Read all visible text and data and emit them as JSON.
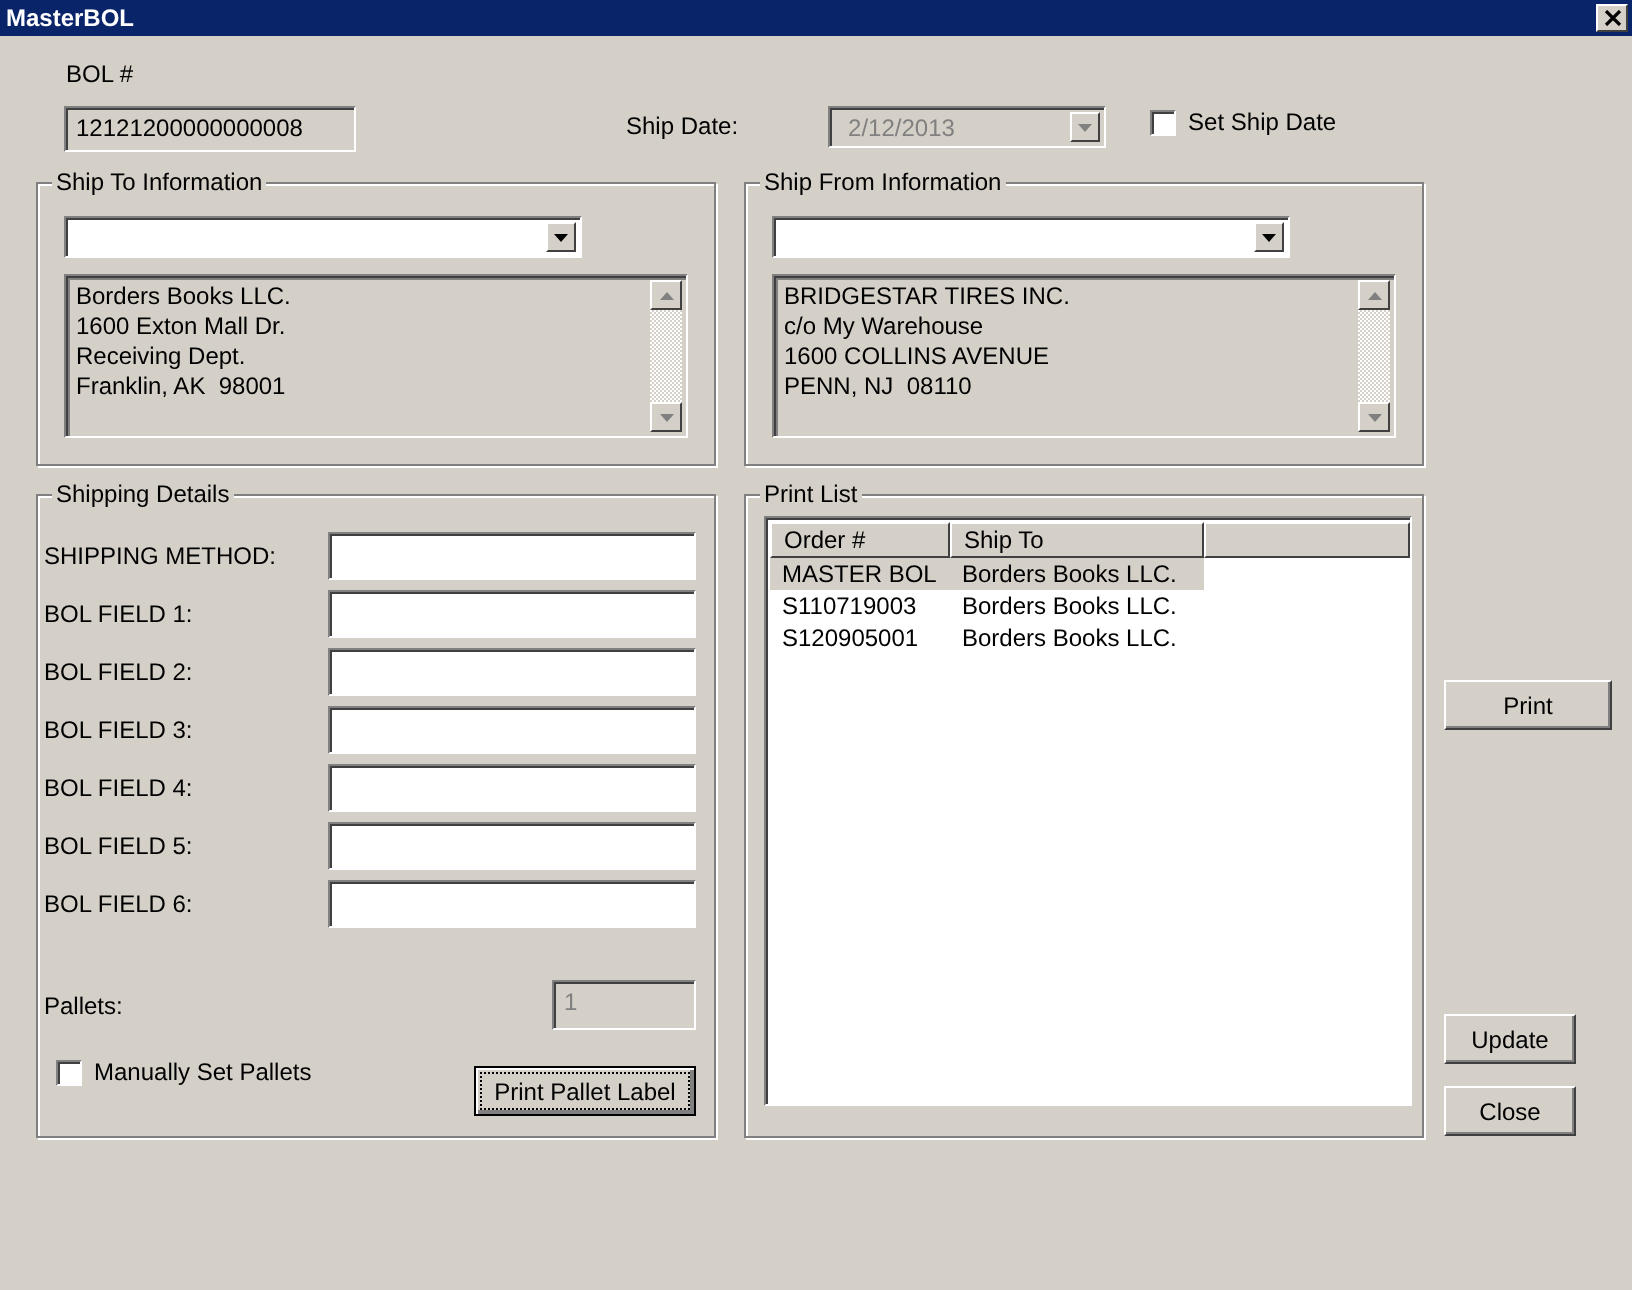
{
  "window": {
    "title": "MasterBOL"
  },
  "bol": {
    "label": "BOL #",
    "value": "12121200000000008"
  },
  "ship_date": {
    "label": "Ship Date:",
    "value": "2/12/2013",
    "disabled": true
  },
  "set_ship_date": {
    "label": "Set Ship Date",
    "checked": false
  },
  "ship_to": {
    "title": "Ship To Information",
    "address": [
      "Borders Books LLC.",
      "1600 Exton Mall Dr.",
      "Receiving Dept.",
      "Franklin, AK  98001"
    ]
  },
  "ship_from": {
    "title": "Ship From Information",
    "address": [
      "BRIDGESTAR TIRES INC.",
      "c/o My Warehouse",
      "1600 COLLINS AVENUE",
      "PENN, NJ  08110"
    ]
  },
  "shipping_details": {
    "title": "Shipping Details",
    "fields": [
      {
        "label": "SHIPPING METHOD:"
      },
      {
        "label": "BOL FIELD 1:"
      },
      {
        "label": "BOL FIELD 2:"
      },
      {
        "label": "BOL FIELD 3:"
      },
      {
        "label": "BOL FIELD 4:"
      },
      {
        "label": "BOL FIELD 5:"
      },
      {
        "label": "BOL FIELD 6:"
      }
    ],
    "pallets": {
      "label": "Pallets:",
      "value": "1",
      "disabled": true
    },
    "manual_pallets": {
      "label": "Manually Set Pallets",
      "checked": false
    },
    "print_pallet_label": "Print Pallet Label"
  },
  "print_list": {
    "title": "Print List",
    "columns": [
      "Order #",
      "Ship To"
    ],
    "rows": [
      {
        "cells": [
          "MASTER BOL",
          "Borders Books LLC."
        ],
        "selected": true
      },
      {
        "cells": [
          "S110719003",
          "Borders Books LLC."
        ],
        "selected": false
      },
      {
        "cells": [
          "S120905001",
          "Borders Books LLC."
        ],
        "selected": false
      }
    ]
  },
  "buttons": [
    "Print",
    "Update",
    "Close"
  ]
}
